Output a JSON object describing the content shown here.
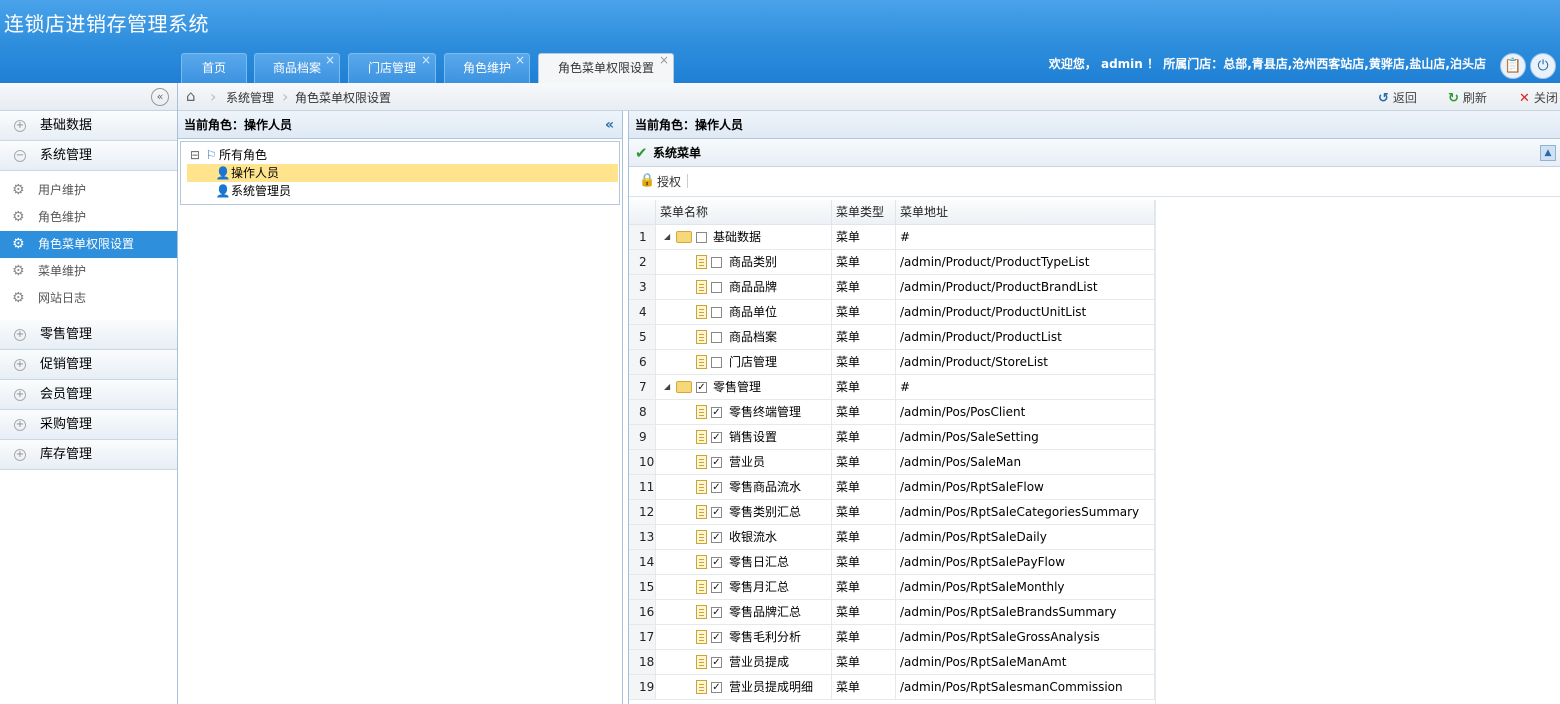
{
  "app": {
    "title": "连锁店进销存管理系统"
  },
  "tabs": [
    {
      "label": "首页",
      "closable": false
    },
    {
      "label": "商品档案",
      "closable": true
    },
    {
      "label": "门店管理",
      "closable": true
    },
    {
      "label": "角色维护",
      "closable": true
    },
    {
      "label": "角色菜单权限设置",
      "closable": true,
      "active": true
    }
  ],
  "header": {
    "welcome": "欢迎您， admin ！ 所属门店：总部,青县店,沧州西客站店,黄骅店,盐山店,泊头店",
    "close_glyph": "×"
  },
  "breadcrumb": {
    "items": [
      "系统管理",
      "角色菜单权限设置"
    ]
  },
  "actions": {
    "back": "返回",
    "refresh": "刷新",
    "close": "关闭"
  },
  "sidebar": {
    "collapse_glyph": "«",
    "groups": [
      {
        "label": "基础数据",
        "expanded": false
      },
      {
        "label": "系统管理",
        "expanded": true
      },
      {
        "label": "零售管理",
        "expanded": false
      },
      {
        "label": "促销管理",
        "expanded": false
      },
      {
        "label": "会员管理",
        "expanded": false
      },
      {
        "label": "采购管理",
        "expanded": false
      },
      {
        "label": "库存管理",
        "expanded": false
      }
    ],
    "system_items": [
      {
        "label": "用户维护"
      },
      {
        "label": "角色维护"
      },
      {
        "label": "角色菜单权限设置",
        "active": true
      },
      {
        "label": "菜单维护"
      },
      {
        "label": "网站日志"
      }
    ]
  },
  "role_panel": {
    "title": "当前角色：操作人员",
    "tree": {
      "root": "所有角色",
      "children": [
        "操作人员",
        "系统管理员"
      ],
      "selected": "操作人员"
    }
  },
  "menu_panel": {
    "title": "当前角色：操作人员",
    "section_title": "系统菜单",
    "toolbar": {
      "auth_label": "授权"
    },
    "grid": {
      "columns": [
        "菜单名称",
        "菜单类型",
        "菜单地址"
      ],
      "rows": [
        {
          "num": "1",
          "name": "基础数据",
          "type": "菜单",
          "url": "#",
          "folder": true,
          "checked": false
        },
        {
          "num": "2",
          "name": "商品类别",
          "type": "菜单",
          "url": "/admin/Product/ProductTypeList",
          "folder": false,
          "checked": false
        },
        {
          "num": "3",
          "name": "商品品牌",
          "type": "菜单",
          "url": "/admin/Product/ProductBrandList",
          "folder": false,
          "checked": false
        },
        {
          "num": "4",
          "name": "商品单位",
          "type": "菜单",
          "url": "/admin/Product/ProductUnitList",
          "folder": false,
          "checked": false
        },
        {
          "num": "5",
          "name": "商品档案",
          "type": "菜单",
          "url": "/admin/Product/ProductList",
          "folder": false,
          "checked": false
        },
        {
          "num": "6",
          "name": "门店管理",
          "type": "菜单",
          "url": "/admin/Product/StoreList",
          "folder": false,
          "checked": false
        },
        {
          "num": "7",
          "name": "零售管理",
          "type": "菜单",
          "url": "#",
          "folder": true,
          "checked": true
        },
        {
          "num": "8",
          "name": "零售终端管理",
          "type": "菜单",
          "url": "/admin/Pos/PosClient",
          "folder": false,
          "checked": true
        },
        {
          "num": "9",
          "name": "销售设置",
          "type": "菜单",
          "url": "/admin/Pos/SaleSetting",
          "folder": false,
          "checked": true
        },
        {
          "num": "10",
          "name": "营业员",
          "type": "菜单",
          "url": "/admin/Pos/SaleMan",
          "folder": false,
          "checked": true
        },
        {
          "num": "11",
          "name": "零售商品流水",
          "type": "菜单",
          "url": "/admin/Pos/RptSaleFlow",
          "folder": false,
          "checked": true
        },
        {
          "num": "12",
          "name": "零售类别汇总",
          "type": "菜单",
          "url": "/admin/Pos/RptSaleCategoriesSummary",
          "folder": false,
          "checked": true
        },
        {
          "num": "13",
          "name": "收银流水",
          "type": "菜单",
          "url": "/admin/Pos/RptSaleDaily",
          "folder": false,
          "checked": true
        },
        {
          "num": "14",
          "name": "零售日汇总",
          "type": "菜单",
          "url": "/admin/Pos/RptSalePayFlow",
          "folder": false,
          "checked": true
        },
        {
          "num": "15",
          "name": "零售月汇总",
          "type": "菜单",
          "url": "/admin/Pos/RptSaleMonthly",
          "folder": false,
          "checked": true
        },
        {
          "num": "16",
          "name": "零售品牌汇总",
          "type": "菜单",
          "url": "/admin/Pos/RptSaleBrandsSummary",
          "folder": false,
          "checked": true
        },
        {
          "num": "17",
          "name": "零售毛利分析",
          "type": "菜单",
          "url": "/admin/Pos/RptSaleGrossAnalysis",
          "folder": false,
          "checked": true
        },
        {
          "num": "18",
          "name": "营业员提成",
          "type": "菜单",
          "url": "/admin/Pos/RptSaleManAmt",
          "folder": false,
          "checked": true
        },
        {
          "num": "19",
          "name": "营业员提成明细",
          "type": "菜单",
          "url": "/admin/Pos/RptSalesmanCommission",
          "folder": false,
          "checked": true
        }
      ]
    }
  },
  "colors": {
    "header": "#2d8ddc",
    "active_menu": "#2e8fdc",
    "selected_node": "#ffe48d"
  },
  "icons": {
    "home": "⌂",
    "back": "↺",
    "refresh": "↻",
    "close": "✕",
    "mid_collapse": "«",
    "check": "✔",
    "lock": "🔒",
    "expand": "▲",
    "clipboard": "📋",
    "power": "⏻",
    "gear": "⚙",
    "tree_minus": "⊟",
    "user": "👤",
    "roles": "⚐"
  }
}
